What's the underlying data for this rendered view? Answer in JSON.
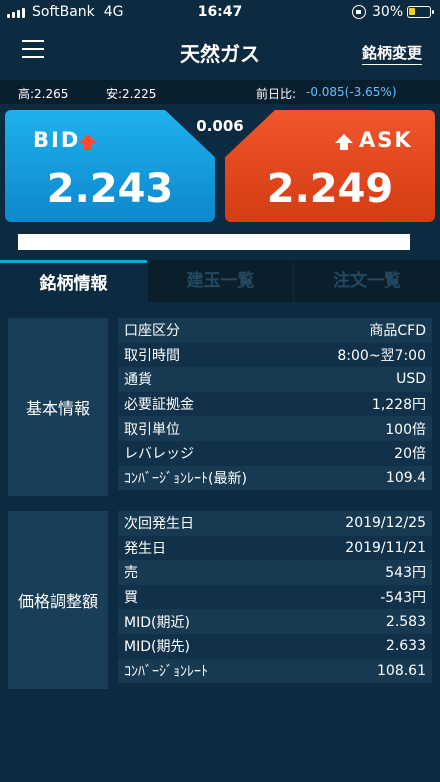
{
  "status_bar": {
    "carrier": "SoftBank",
    "network": "4G",
    "time": "16:47",
    "battery": "30%",
    "battery_level": 0.3
  },
  "header": {
    "title": "天然ガス",
    "right_link": "銘柄変更"
  },
  "quote": {
    "high": "高:2.265",
    "low": "安:2.225",
    "change_label": "前日比:",
    "change_value": "-0.085(-3.65%)"
  },
  "bid": {
    "label": "BID",
    "price": "2.243"
  },
  "ask": {
    "label": "ASK",
    "price": "2.249"
  },
  "spread": "0.006",
  "tabs": [
    {
      "label": "銘柄情報"
    },
    {
      "label": "建玉一覧"
    },
    {
      "label": "注文一覧"
    }
  ],
  "sections": [
    {
      "label": "基本情報",
      "rows": [
        {
          "key": "口座区分",
          "value": "商品CFD"
        },
        {
          "key": "取引時間",
          "value": "8:00~翌7:00"
        },
        {
          "key": "通貨",
          "value": "USD"
        },
        {
          "key": "必要証拠金",
          "value": "1,228円"
        },
        {
          "key": "取引単位",
          "value": "100倍"
        },
        {
          "key": "レバレッジ",
          "value": "20倍"
        },
        {
          "key": "ｺﾝﾊﾞｰｼﾞｮﾝﾚｰﾄ(最新)",
          "value": "109.4"
        }
      ]
    },
    {
      "label": "価格調整額",
      "rows": [
        {
          "key": "次回発生日",
          "value": "2019/12/25"
        },
        {
          "key": "発生日",
          "value": "2019/11/21"
        },
        {
          "key": "売",
          "value": "543円"
        },
        {
          "key": "買",
          "value": "-543円"
        },
        {
          "key": "MID(期近)",
          "value": "2.583"
        },
        {
          "key": "MID(期先)",
          "value": "2.633"
        },
        {
          "key": "ｺﾝﾊﾞｰｼﾞｮﾝﾚｰﾄ",
          "value": "108.61"
        }
      ]
    }
  ]
}
